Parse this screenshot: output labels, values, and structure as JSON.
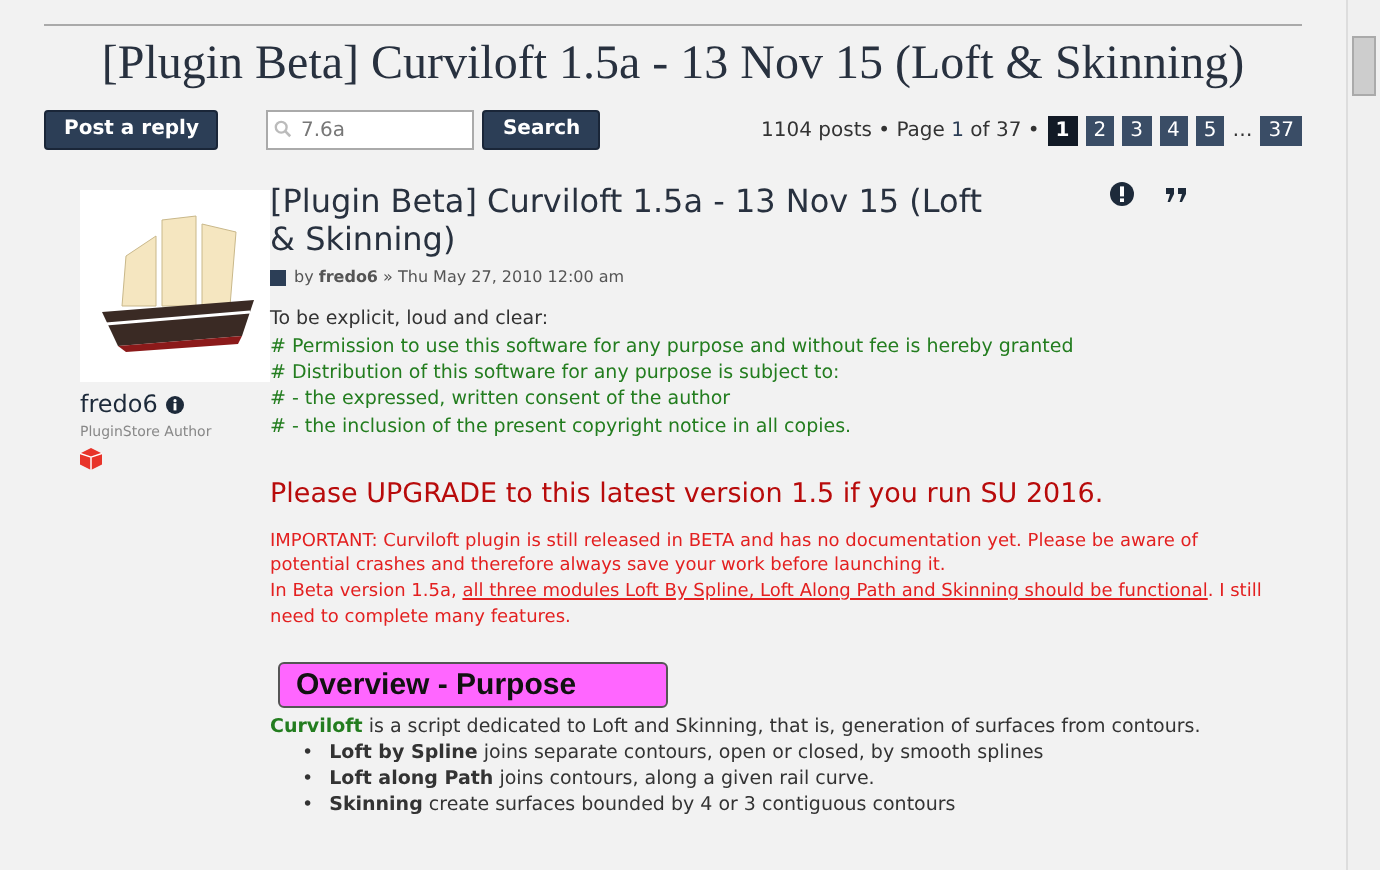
{
  "topic_title": "[Plugin Beta] Curviloft 1.5a - 13 Nov 15 (Loft & Skinning)",
  "actions": {
    "reply_button": "Post a reply",
    "search": {
      "value": "7.6a"
    },
    "search_button": "Search"
  },
  "pagination": {
    "summary": "1104 posts • Page ",
    "current": "1",
    "of": " of 37 •",
    "pages": [
      {
        "label": "1",
        "selected": true
      },
      {
        "label": "2",
        "selected": false
      },
      {
        "label": "3",
        "selected": false
      },
      {
        "label": "4",
        "selected": false
      },
      {
        "label": "5",
        "selected": false
      },
      {
        "label": "…",
        "kind": "gap"
      },
      {
        "label": "37",
        "selected": false
      }
    ]
  },
  "author": {
    "name": "fredo6",
    "rank": "PluginStore Author"
  },
  "post": {
    "title": "[Plugin Beta] Curviloft 1.5a - 13 Nov 15 (Loft & Skinning)",
    "byline": "by **fredo6** » Thu May 27, 2010 12:00 am",
    "intro": "To be explicit, loud and clear:",
    "license_lines": [
      "# Permission to use this software for any purpose and without fee is hereby granted",
      "# Distribution of this software for any purpose is subject to:",
      "# - the expressed, written consent of the author",
      "# - the inclusion of the present copyright notice in all copies."
    ],
    "upgrade_notice": "Please UPGRADE to this latest version 1.5 if you run SU 2016.",
    "important": [
      {
        "text": "IMPORTANT: Curviloft plugin is still released in BETA and has no documentation yet. Please be aware of potential crashes and therefore always save your work before launching it.",
        "underlined": false,
        "break_after": true
      },
      {
        "text": "In Beta version 1.5a, ",
        "underlined": false,
        "break_after": false
      },
      {
        "text": "all three modules Loft By Spline, Loft Along Path and Skinning should be functional",
        "underlined": true,
        "break_after": false
      },
      {
        "text": ". I still need to complete many features.",
        "underlined": false,
        "break_after": false
      }
    ],
    "section_heading": "Overview - Purpose",
    "overview": [
      {
        "text": "Curviloft",
        "highlight": true
      },
      {
        "text": " is a script dedicated to Loft and Skinning, that is, generation of surfaces from contours.",
        "highlight": false
      }
    ],
    "bullets": [
      {
        "marker": "•",
        "text": "**Loft by Spline** joins separate contours, open or closed, by smooth splines"
      },
      {
        "marker": "•",
        "text": "**Loft along Path** joins contours, along a given rail curve."
      },
      {
        "marker": "•",
        "text": "**Skinning** create surfaces bounded by 4 or 3 contiguous contours"
      }
    ]
  }
}
